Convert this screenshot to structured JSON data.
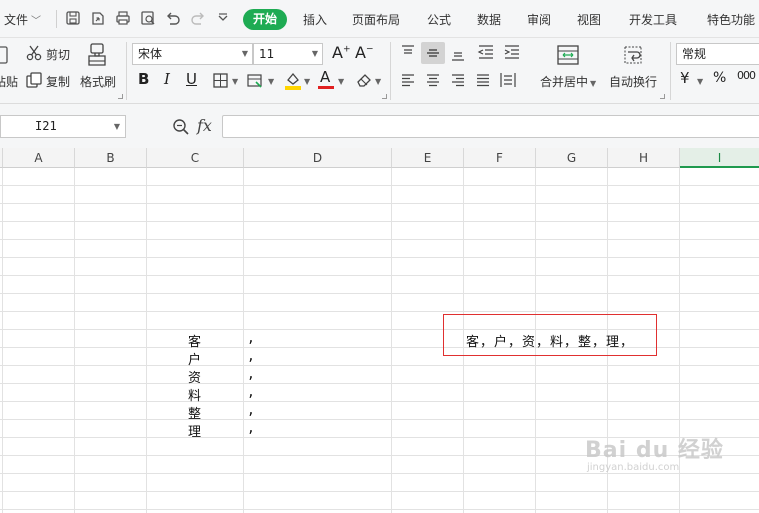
{
  "tabs": {
    "file": "文件",
    "start": "开始",
    "insert": "插入",
    "layout": "页面布局",
    "formula": "公式",
    "data": "数据",
    "review": "审阅",
    "view": "视图",
    "developer": "开发工具",
    "special": "特色功能"
  },
  "ribbon": {
    "paste_label": "粘贴",
    "cut_label": "剪切",
    "copy_label": "复制",
    "format_painter_label": "格式刷",
    "font_name": "宋体",
    "font_size": "11",
    "merge_center_label": "合并居中",
    "wrap_text_label": "自动换行",
    "number_format": "常规",
    "accent_color": "#1eab53",
    "font_color": "#e02020",
    "fill_color": "#ffd500"
  },
  "formula_bar": {
    "name_box": "I21",
    "formula_value": ""
  },
  "columns": [
    "A",
    "B",
    "C",
    "D",
    "E",
    "F",
    "G",
    "H",
    "I"
  ],
  "active_column": "I",
  "cells": {
    "c_column": [
      "客",
      "户",
      "资",
      "料",
      "整",
      "理"
    ],
    "d_column": [
      ",",
      ",",
      ",",
      ",",
      ",",
      ","
    ],
    "merged_result": "客，户，资，料，整，理，"
  },
  "watermark": {
    "main": "Bai du 经验",
    "sub": "jingyan.baidu.com"
  }
}
